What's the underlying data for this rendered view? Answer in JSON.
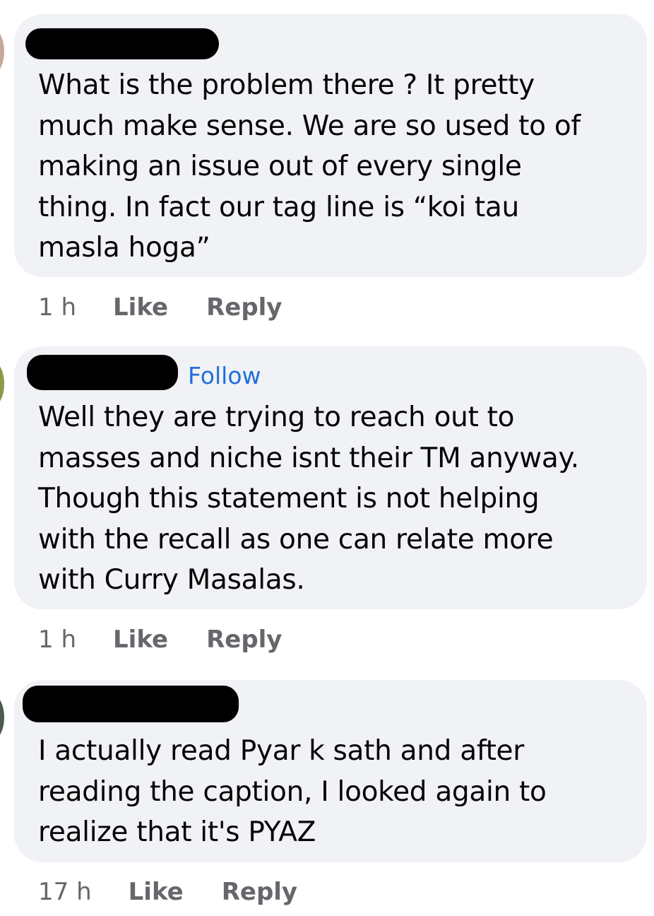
{
  "comments": [
    {
      "follow": "",
      "text": "What is the problem there ? It pretty\nmuch make sense. We are so used to of\nmaking an issue out of every single\nthing. In fact our tag line is “koi tau\nmasla hoga”",
      "time": "1 h",
      "like": "Like",
      "reply": "Reply"
    },
    {
      "follow": "Follow",
      "text": "Well they are trying to reach out to\nmasses and niche isnt their TM anyway.\nThough this statement is not helping\nwith the recall as one can relate more\nwith Curry Masalas.",
      "time": "1 h",
      "like": "Like",
      "reply": "Reply"
    },
    {
      "follow": "",
      "text": "I actually read Pyar k sath and after\nreading the caption, I looked again to\nrealize that it's PYAZ",
      "time": "17 h",
      "like": "Like",
      "reply": "Reply"
    }
  ],
  "colors": {
    "bubble": "#f0f2f5",
    "link": "#216fdb",
    "meta": "#65676b",
    "text": "#050505"
  }
}
